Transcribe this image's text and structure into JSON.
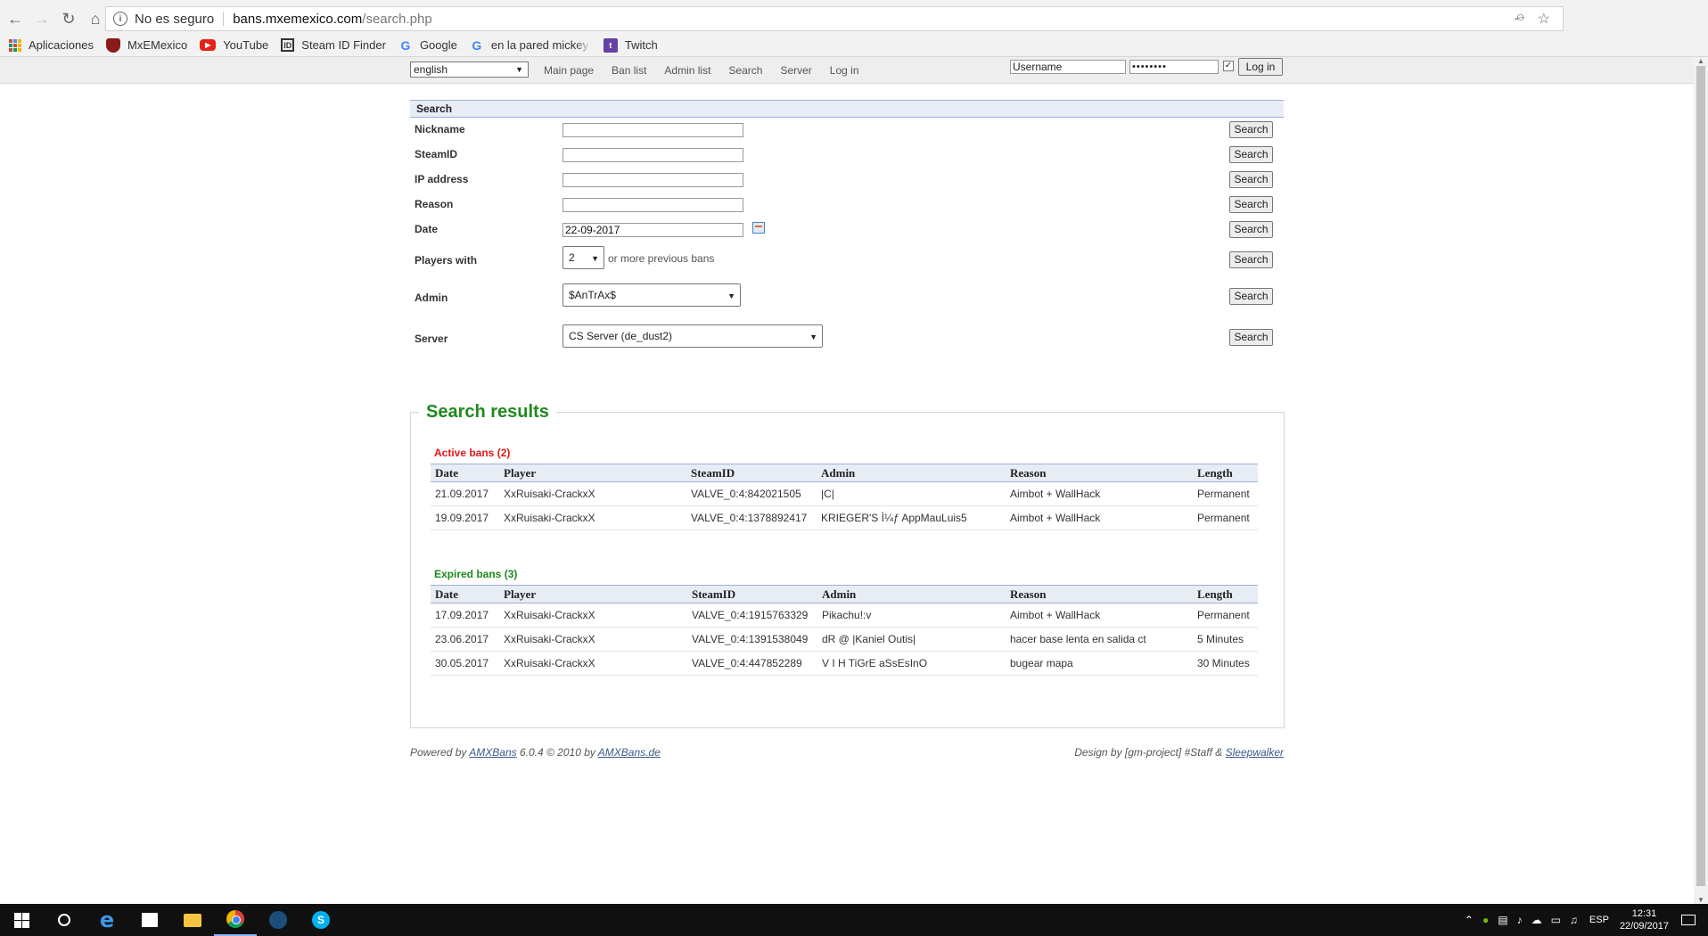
{
  "browser": {
    "security": "No es seguro",
    "host": "bans.mxemexico.com",
    "path": "/search.php",
    "bookmarks": [
      {
        "label": "Aplicaciones",
        "icon": "apps-grid-icon"
      },
      {
        "label": "MxEMexico",
        "icon": "shield-icon"
      },
      {
        "label": "YouTube",
        "icon": "youtube-icon"
      },
      {
        "label": "Steam ID Finder",
        "icon": "id-icon"
      },
      {
        "label": "Google",
        "icon": "google-icon"
      },
      {
        "label": "en la pared mickey de",
        "icon": "google-icon"
      },
      {
        "label": "Twitch",
        "icon": "twitch-icon"
      }
    ]
  },
  "nav": {
    "language": "english",
    "links": [
      "Main page",
      "Ban list",
      "Admin list",
      "Search",
      "Server",
      "Log in"
    ],
    "username_placeholder": "Username",
    "password_value": "••••••••",
    "login_label": "Log in"
  },
  "search": {
    "heading": "Search",
    "button_label": "Search",
    "nickname_label": "Nickname",
    "steamid_label": "SteamID",
    "ip_label": "IP address",
    "reason_label": "Reason",
    "date_label": "Date",
    "date_value": "22-09-2017",
    "players_label": "Players with",
    "players_value": "2",
    "players_suffix": "or more previous bans",
    "admin_label": "Admin",
    "admin_value": "$AnTrAx$",
    "server_label": "Server",
    "server_value": "CS Server (de_dust2)"
  },
  "results": {
    "title": "Search results",
    "columns": [
      "Date",
      "Player",
      "SteamID",
      "Admin",
      "Reason",
      "Length"
    ],
    "active_title": "Active bans (2)",
    "active": [
      [
        "21.09.2017",
        "XxRuisaki-CrackxX",
        "VALVE_0:4:842021505",
        "|C|",
        "Aimbot + WallHack",
        "Permanent"
      ],
      [
        "19.09.2017",
        "XxRuisaki-CrackxX",
        "VALVE_0:4:1378892417",
        "KRIEGER'S Ì¼ƒ AppMauLuis5",
        "Aimbot + WallHack",
        "Permanent"
      ]
    ],
    "expired_title": "Expired bans (3)",
    "expired": [
      [
        "17.09.2017",
        "XxRuisaki-CrackxX",
        "VALVE_0:4:1915763329",
        "Pikachu!:v",
        "Aimbot + WallHack",
        "Permanent"
      ],
      [
        "23.06.2017",
        "XxRuisaki-CrackxX",
        "VALVE_0:4:1391538049",
        "dR @ |Kaniel Outis|",
        "hacer base lenta en salida ct",
        "5 Minutes"
      ],
      [
        "30.05.2017",
        "XxRuisaki-CrackxX",
        "VALVE_0:4:447852289",
        "V I H TiGrE aSsEsInO",
        "bugear mapa",
        "30 Minutes"
      ]
    ]
  },
  "footer": {
    "powered_prefix": "Powered by",
    "amxbans": "AMXBans",
    "version": "6.0.4 © 2010 by",
    "amxbans_de": "AMXBans.de",
    "design_prefix": "Design by [gm-project] #Staff &",
    "sleepwalker": "Sleepwalker"
  },
  "taskbar": {
    "language": "ESP",
    "time": "12:31",
    "date": "22/09/2017"
  }
}
